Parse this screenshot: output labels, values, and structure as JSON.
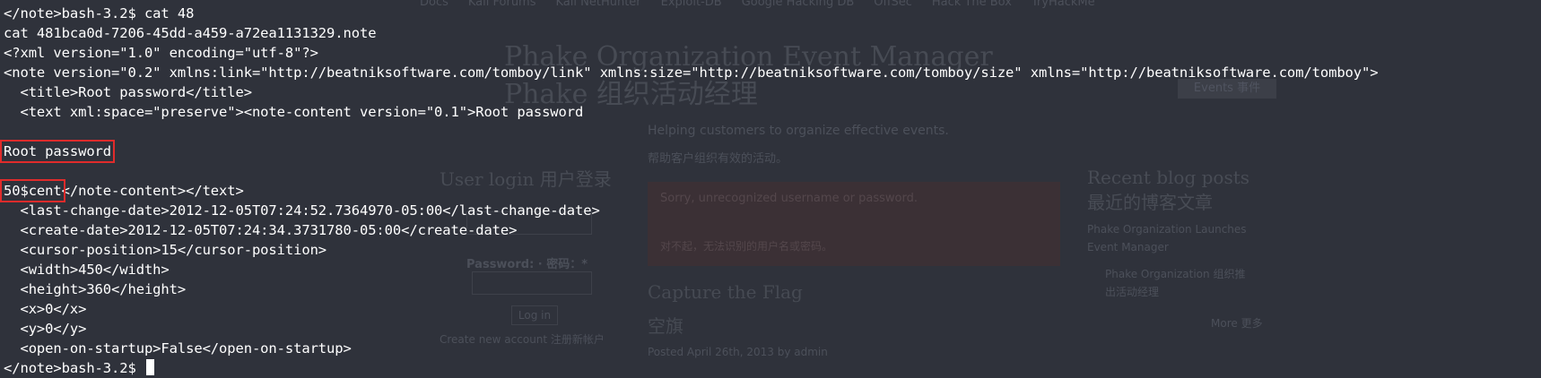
{
  "background": {
    "bookmarks": [
      "Docs",
      "Kali Forums",
      "Kali NetHunter",
      "Exploit-DB",
      "Google Hacking DB",
      "OffSec",
      "Hack The Box",
      "TryHackMe"
    ],
    "site_title": "Phake Organization Event Manager",
    "site_subtitle": "Phake 组织活动经理",
    "events_button": "Events 事件",
    "slogan_en": "Helping customers to organize effective events.",
    "slogan_cn": "帮助客户组织有效的活动。",
    "login_heading": "User login  用户登录",
    "error_en": "Sorry, unrecognized username or password.",
    "error_cn": "对不起，无法识别的用户名或密码。",
    "password_label": "Password: · 密码：*",
    "login_button": "Log in",
    "register_link": "Create new account  注册新帐户",
    "captcha_heading": "Capture the Flag",
    "captcha_cn": "空旗",
    "posted": "Posted April 26th, 2013 by admin",
    "blog_heading": "Recent blog posts  最近的博客文章",
    "blog_item1": "Phake Organization Launches Event Manager",
    "blog_item2": "Phake Organization 组织推出活动经理",
    "blog_more": "More  更多"
  },
  "terminal": {
    "lines": [
      "</note>bash-3.2$ cat 48",
      "cat 481bca0d-7206-45dd-a459-a72ea1131329.note",
      "<?xml version=\"1.0\" encoding=\"utf-8\"?>",
      "<note version=\"0.2\" xmlns:link=\"http://beatniksoftware.com/tomboy/link\" xmlns:size=\"http://beatniksoftware.com/tomboy/size\" xmlns=\"http://beatniksoftware.com/tomboy\">",
      "  <title>Root password</title>",
      "  <text xml:space=\"preserve\"><note-content version=\"0.1\">Root password",
      "",
      "Root password",
      "",
      "50$cent</note-content></text>",
      "  <last-change-date>2012-12-05T07:24:52.7364970-05:00</last-change-date>",
      "  <create-date>2012-12-05T07:24:34.3731780-05:00</create-date>",
      "  <cursor-position>15</cursor-position>",
      "  <width>450</width>",
      "  <height>360</height>",
      "  <x>0</x>",
      "  <y>0</y>",
      "  <open-on-startup>False</open-on-startup>"
    ],
    "highlight_title": "Root password",
    "highlight_secret": "50$cent",
    "secret_tail": "</note-content></text>",
    "prompt": "</note>bash-3.2$ ",
    "highlight_color": "#e02b2b"
  }
}
